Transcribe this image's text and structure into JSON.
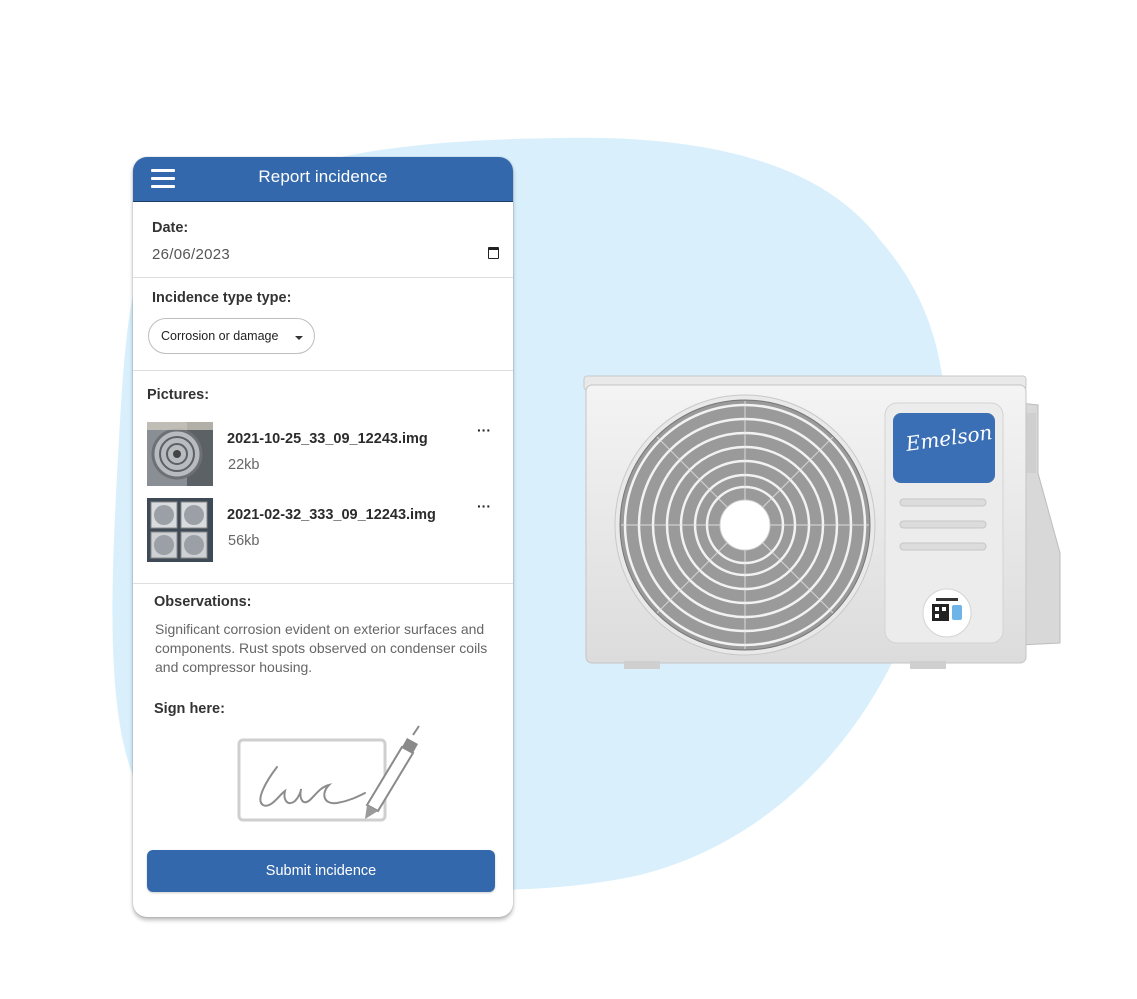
{
  "app": {
    "title": "Report incidence"
  },
  "form": {
    "date_label": "Date:",
    "date_value": "26/06/2023",
    "incidence_type_label": "Incidence type type:",
    "incidence_type_value": "Corrosion or damage",
    "pictures_label": "Pictures:",
    "pictures": [
      {
        "name": "2021-10-25_33_09_12243.img",
        "size": "22kb"
      },
      {
        "name": "2021-02-32_333_09_12243.img",
        "size": "56kb"
      }
    ],
    "observations_label": "Observations:",
    "observations_text": "Significant corrosion evident on exterior surfaces and components. Rust spots observed on condenser coils and compressor housing.",
    "sign_label": "Sign here:",
    "submit_label": "Submit incidence"
  },
  "product": {
    "brand": "Emelson"
  },
  "icons": {
    "menu": "hamburger-menu-icon",
    "calendar": "calendar-icon",
    "dropdown": "caret-down-icon",
    "more": "more-options-icon",
    "pen": "pen-icon"
  },
  "colors": {
    "primary": "#3468ad",
    "backdrop": "#d9f0fc",
    "brand_panel": "#3a6fb5"
  }
}
